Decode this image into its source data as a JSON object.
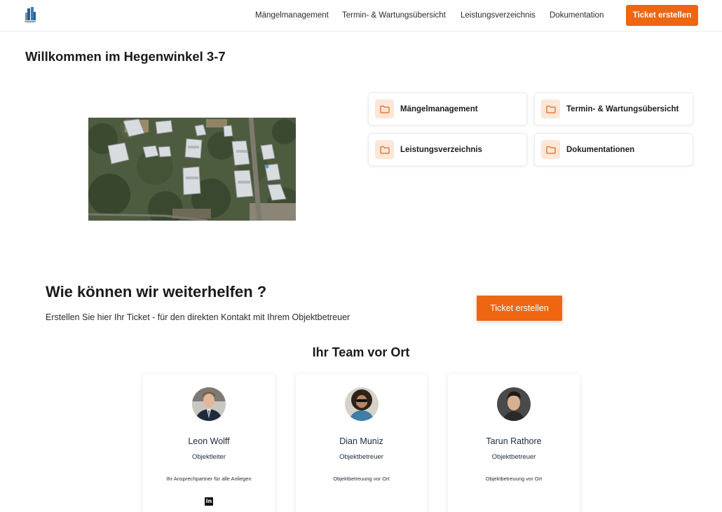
{
  "header": {
    "nav": [
      "Mängelmanagement",
      "Termin- & Wartungsübersicht",
      "Leistungsverzeichnis",
      "Dokumentation"
    ],
    "cta_label": "Ticket erstellen"
  },
  "page": {
    "title": "Willkommen im Hegenwinkel 3-7"
  },
  "quick_links": [
    {
      "label": "Mängelmanagement",
      "icon": "folder-icon"
    },
    {
      "label": "Termin- & Wartungsübersicht",
      "icon": "folder-icon"
    },
    {
      "label": "Leistungsverzeichnis",
      "icon": "folder-icon"
    },
    {
      "label": "Dokumentationen",
      "icon": "folder-icon"
    }
  ],
  "help": {
    "title": "Wie können wir weiterhelfen ?",
    "subtitle": "Erstellen Sie hier Ihr Ticket - für den direkten Kontakt mit Ihrem Objektbetreuer",
    "button": "Ticket erstellen"
  },
  "team": {
    "title": "Ihr Team vor Ort",
    "members": [
      {
        "name": "Leon Wolff",
        "role": "Objektleiter",
        "desc": "Ihr Ansprechpartner für alle Anliegen",
        "social": "linkedin-icon"
      },
      {
        "name": "Dian Muniz",
        "role": "Objektbetreuer",
        "desc": "Objektbetreuung vor Ort"
      },
      {
        "name": "Tarun Rathore",
        "role": "Objektbetreuer",
        "desc": "Objektbetreuung vor Ort"
      }
    ]
  },
  "colors": {
    "accent": "#ee6611",
    "icon_bg": "#fbe7da"
  }
}
